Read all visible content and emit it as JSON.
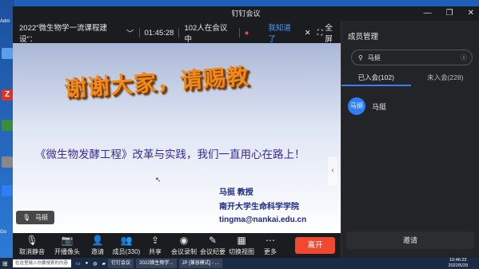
{
  "window": {
    "title": "钉钉会议"
  },
  "desktop": {
    "labels": [
      "Adm",
      "Z",
      "Go"
    ]
  },
  "infobar": {
    "meeting_title": "2022\"微生物学一流课程建设\"：",
    "time": "01:45:28",
    "participants": "102人在会议中",
    "known_label": "我知道了",
    "fullscreen_label": "全屏"
  },
  "slide": {
    "thanks": "谢谢大家，请赐教",
    "subtitle": "《微生物发酵工程》改革与实践，我们一直用心在路上！",
    "name": "马挺 教授",
    "affiliation": "南开大学生命科学学院",
    "email": "tingma@nankai.edu.cn"
  },
  "speaker": {
    "name": "马挺"
  },
  "toolbar": {
    "buttons": [
      {
        "label": "取消静音",
        "icon": "mic-off-icon"
      },
      {
        "label": "开播像头",
        "icon": "camera-off-icon"
      },
      {
        "label": "邀请",
        "icon": "add-user-icon"
      },
      {
        "label": "成员(330)",
        "icon": "members-icon"
      },
      {
        "label": "共享",
        "icon": "share-icon"
      },
      {
        "label": "会议录制",
        "icon": "record-icon"
      },
      {
        "label": "会议纪要",
        "icon": "notes-icon"
      },
      {
        "label": "切换视图",
        "icon": "grid-icon"
      },
      {
        "label": "更多",
        "icon": "more-icon"
      }
    ],
    "leave_label": "离开"
  },
  "panel": {
    "title": "成员管理",
    "search_value": "马挺",
    "tabs": [
      "已入会(102)",
      "未入会(228)"
    ],
    "member": {
      "avatar": "马挺",
      "name": "马挺"
    },
    "invite_label": "邀请"
  },
  "taskbar": {
    "search_placeholder": "在这里输入你要搜索的内容",
    "tasks": [
      "钉钉会议",
      "2022微生物学...",
      "JP [兼容模式] - ..."
    ],
    "time": "10:46:23",
    "date": "2022/5/29"
  },
  "colors": {
    "accent": "#2f7ef5",
    "leave": "#f1492f",
    "link": "#4c9cff"
  }
}
